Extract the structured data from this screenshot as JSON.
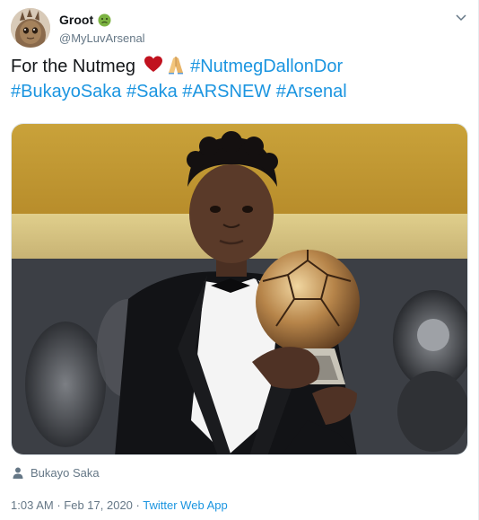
{
  "user": {
    "display_name": "Groot",
    "handle": "@MyLuvArsenal",
    "avatar": "groot-avatar",
    "badge_emoji": "nauseated-face-emoji"
  },
  "tweet": {
    "text_lead": "For the Nutmeg",
    "emojis": [
      "red-heart-emoji",
      "folded-hands-emoji"
    ],
    "hashtags": [
      "#NutmegDallonDor",
      "#BukayoSaka",
      "#Saka",
      "#ARSNEW",
      "#Arsenal"
    ],
    "media": "photo-player-holding-golden-ball-trophy",
    "tagged_person": "Bukayo Saka",
    "time": "1:03 AM",
    "date": "Feb 17, 2020",
    "separator": "·",
    "source": "Twitter Web App"
  },
  "icons": {
    "menu": "chevron-down-icon",
    "tag": "person-icon"
  },
  "colors": {
    "link": "#1b95e0",
    "secondary_text": "#657786",
    "primary_text": "#14171a",
    "heart": "#c1121f"
  }
}
